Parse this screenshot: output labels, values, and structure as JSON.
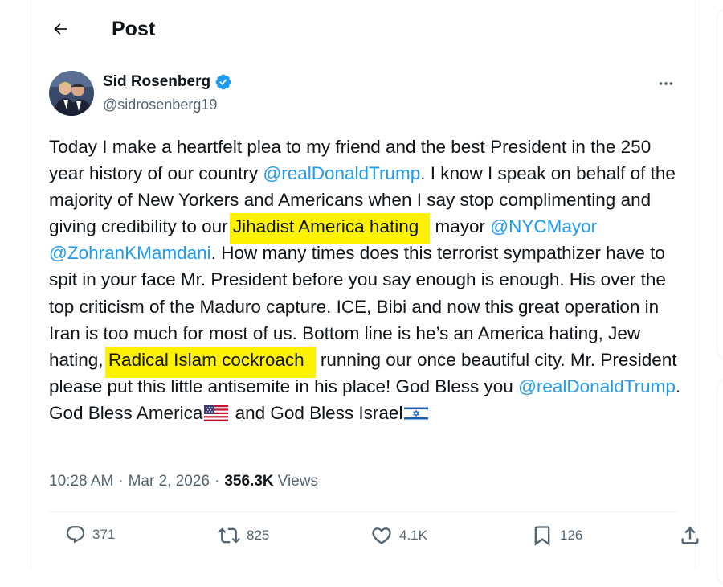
{
  "header": {
    "title": "Post"
  },
  "post": {
    "author": {
      "display_name": "Sid Rosenberg",
      "handle": "@sidrosenberg19",
      "verified": true
    },
    "text_segments": [
      {
        "type": "text",
        "value": "Today I make a heartfelt plea to my friend and the best President in the 250 year history of our country "
      },
      {
        "type": "mention",
        "value": "@realDonaldTrump"
      },
      {
        "type": "text",
        "value": ". I know I speak on behalf of the majority of New Yorkers and Americans when I say stop complimenting and giving credibility to our "
      },
      {
        "type": "highlight",
        "value": "Jihadist America hating"
      },
      {
        "type": "text",
        "value": " mayor "
      },
      {
        "type": "mention",
        "value": "@NYCMayor"
      },
      {
        "type": "text",
        "value": " "
      },
      {
        "type": "mention",
        "value": "@ZohranKMamdani"
      },
      {
        "type": "text",
        "value": ". How many times does this terrorist sympathizer have to spit in your face Mr. President before you say enough is enough. His over the top criticism of the Maduro capture. ICE, Bibi and now this great operation in Iran is too much for most of us. Bottom line is he’s an America hating, Jew hating, "
      },
      {
        "type": "highlight",
        "value": "Radical Islam cockroach"
      },
      {
        "type": "text",
        "value": " running our once beautiful city. Mr. President please put this little antisemite in his place! God Bless you "
      },
      {
        "type": "mention",
        "value": "@realDonaldTrump"
      },
      {
        "type": "text",
        "value": ". God Bless America"
      },
      {
        "type": "flag",
        "value": "us-flag-emoji"
      },
      {
        "type": "text",
        "value": " and God Bless Israel"
      },
      {
        "type": "flag",
        "value": "israel-flag-emoji"
      }
    ],
    "meta": {
      "time": "10:28 AM",
      "separator": "·",
      "date": "Mar 2, 2026",
      "views_count": "356.3K",
      "views_label": "Views"
    },
    "actions": {
      "replies": "371",
      "reposts": "825",
      "likes": "4.1K",
      "bookmarks": "126"
    }
  },
  "colors": {
    "accent": "#1d9bf0",
    "highlight": "#fff200",
    "muted_text": "#536471",
    "text": "#0f1419"
  },
  "icons": [
    "back-arrow-icon",
    "verified-badge-icon",
    "more-icon",
    "reply-icon",
    "repost-icon",
    "like-icon",
    "bookmark-icon",
    "share-icon"
  ]
}
